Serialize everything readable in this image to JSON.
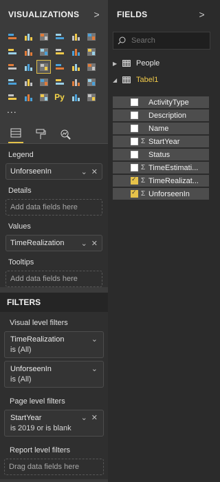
{
  "visualizations": {
    "title": "VISUALIZATIONS",
    "more": "...",
    "icons": [
      "stacked-bar-icon",
      "stacked-column-icon",
      "clustered-bar-icon",
      "clustered-column-icon",
      "100-bar-icon",
      "100-column-icon",
      "line-chart-icon",
      "area-chart-icon",
      "stacked-area-icon",
      "line-column-icon",
      "line-clustered-icon",
      "ribbon-chart-icon",
      "waterfall-icon",
      "scatter-icon",
      "pie-chart-icon",
      "donut-icon",
      "treemap-icon",
      "map-icon",
      "filled-map-icon",
      "funnel-icon",
      "gauge-icon",
      "card-icon",
      "multirow-card-icon",
      "kpi-icon",
      "slicer-icon",
      "table-icon",
      "matrix-icon",
      "python-visual-icon",
      "r-visual-icon",
      "globe-icon"
    ],
    "python_label": "Py",
    "tabs": [
      "fields-tab",
      "format-tab",
      "analytics-tab"
    ]
  },
  "wells": {
    "legend_label": "Legend",
    "legend_value": "UnforseenIn",
    "details_label": "Details",
    "details_placeholder": "Add data fields here",
    "values_label": "Values",
    "values_value": "TimeRealization",
    "tooltips_label": "Tooltips",
    "tooltips_placeholder": "Add data fields here"
  },
  "filters": {
    "title": "FILTERS",
    "visual_level_label": "Visual level filters",
    "visual_filters": [
      {
        "field": "TimeRealization",
        "condition": "is (All)"
      },
      {
        "field": "UnforseenIn",
        "condition": "is (All)"
      }
    ],
    "page_level_label": "Page level filters",
    "page_filters": [
      {
        "field": "StartYear",
        "condition": "is 2019 or is blank"
      }
    ],
    "report_level_label": "Report level filters",
    "report_placeholder": "Drag data fields here"
  },
  "fields_pane": {
    "title": "FIELDS",
    "search_placeholder": "Search",
    "tables": [
      {
        "name": "People",
        "expanded": false
      },
      {
        "name": "Tabel1",
        "expanded": true
      }
    ],
    "fields": [
      {
        "name": "ActivityType",
        "checked": false,
        "sigma": false
      },
      {
        "name": "Description",
        "checked": false,
        "sigma": false
      },
      {
        "name": "Name",
        "checked": false,
        "sigma": false
      },
      {
        "name": "StartYear",
        "checked": false,
        "sigma": true
      },
      {
        "name": "Status",
        "checked": false,
        "sigma": false
      },
      {
        "name": "TimeEstimati...",
        "checked": false,
        "sigma": true
      },
      {
        "name": "TimeRealizat...",
        "checked": true,
        "sigma": true
      },
      {
        "name": "UnforseenIn",
        "checked": true,
        "sigma": true
      }
    ]
  },
  "colors": {
    "accent": "#e3c149",
    "checked": "#e6c24a"
  }
}
